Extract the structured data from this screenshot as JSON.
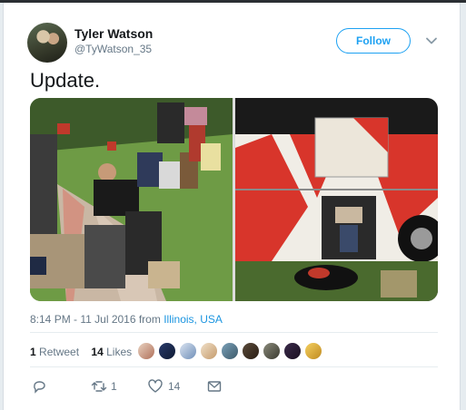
{
  "tweet": {
    "user": {
      "name": "Tyler Watson",
      "handle": "@TyWatson_35"
    },
    "follow_label": "Follow",
    "text": "Update.",
    "timestamp": "8:14 PM - 11 Jul 2016 from",
    "location": "Illinois, USA",
    "retweet_count": "1",
    "retweet_word": "Retweet",
    "like_count": "14",
    "like_word": "Likes",
    "action_retweets": "1",
    "action_likes": "14"
  },
  "colors": {
    "accent": "#1da1f2",
    "text": "#14171a",
    "muted": "#657786",
    "bus_red": "#d8352b"
  },
  "icons": [
    "chevron-down-icon",
    "reply-icon",
    "retweet-icon",
    "heart-icon",
    "mail-icon"
  ]
}
